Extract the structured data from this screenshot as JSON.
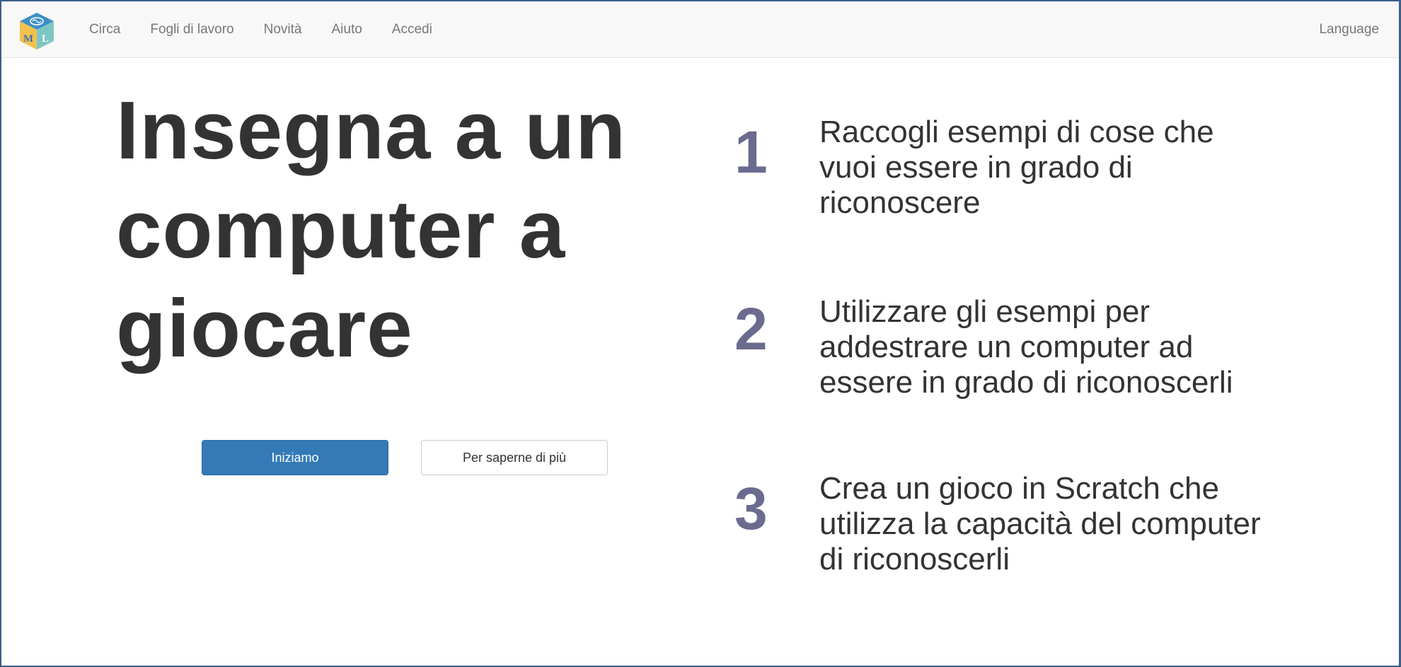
{
  "navbar": {
    "logo_letters": [
      "M",
      "L"
    ],
    "links": [
      {
        "label": "Circa"
      },
      {
        "label": "Fogli di lavoro"
      },
      {
        "label": "Novità"
      },
      {
        "label": "Aiuto"
      },
      {
        "label": "Accedi"
      }
    ],
    "language_label": "Language"
  },
  "hero": {
    "title_lines": [
      "Insegna a un",
      "computer a",
      "giocare"
    ],
    "primary_button": "Iniziamo",
    "secondary_button": "Per saperne di più"
  },
  "steps": [
    {
      "number": "1",
      "text_lines": [
        "Raccogli esempi di cose che",
        "vuoi essere in grado di",
        "riconoscere"
      ]
    },
    {
      "number": "2",
      "text_lines": [
        "Utilizzare gli esempi per",
        "addestrare un computer ad",
        "essere in grado di riconoscerli"
      ]
    },
    {
      "number": "3",
      "text_lines": [
        "Crea un gioco in Scratch che",
        "utilizza la capacità del computer",
        "di riconoscerli"
      ]
    }
  ],
  "colors": {
    "primary": "#337ab7",
    "step_number": "#6b6b8f",
    "title": "#333333",
    "nav_text": "#777777"
  },
  "icons": {
    "logo": "ml-cube-logo-icon"
  }
}
